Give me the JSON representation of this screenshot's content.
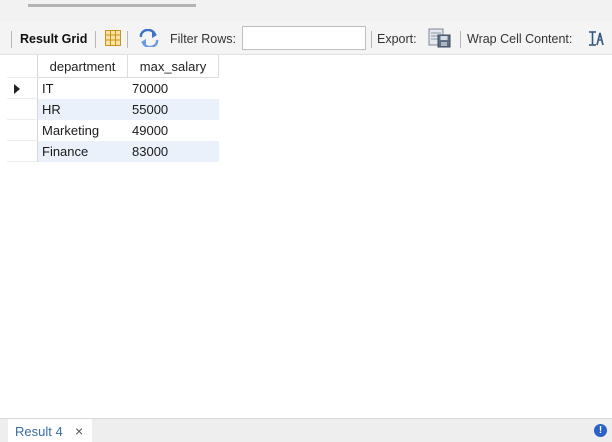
{
  "toolbar": {
    "result_grid_label": "Result Grid",
    "filter_rows_label": "Filter Rows:",
    "filter_value": "",
    "export_label": "Export:",
    "wrap_label": "Wrap Cell Content:"
  },
  "grid": {
    "columns": [
      "department",
      "max_salary"
    ],
    "rows": [
      [
        "IT",
        "70000"
      ],
      [
        "HR",
        "55000"
      ],
      [
        "Marketing",
        "49000"
      ],
      [
        "Finance",
        "83000"
      ]
    ],
    "current_row": 0
  },
  "bottom": {
    "tab_label": "Result 4",
    "close_glyph": "×",
    "info_glyph": "!"
  },
  "colors": {
    "row_alt": "#eaf1fb",
    "tab_text": "#3a6ea5",
    "accent": "#2a62c6"
  },
  "icons": [
    "grid-view-icon",
    "refresh-icon",
    "export-icon",
    "wrap-text-icon",
    "close-icon",
    "info-icon"
  ]
}
